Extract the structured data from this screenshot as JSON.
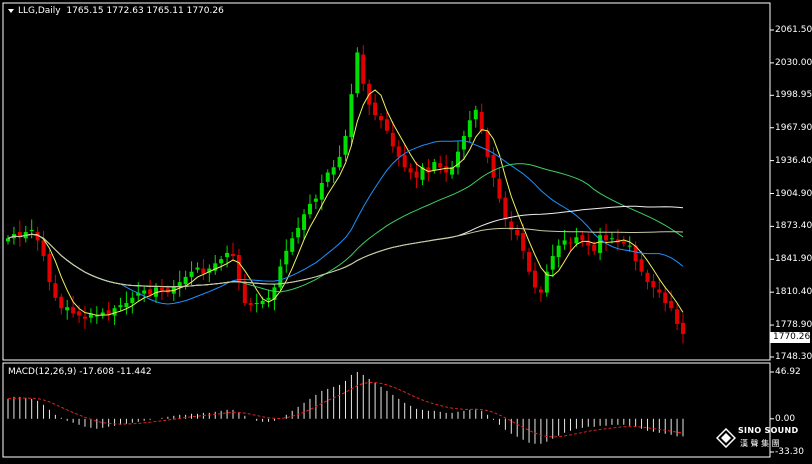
{
  "header": {
    "symbol_timeframe": "LLG,Daily",
    "ohlc": "1765.15 1772.63 1765.11 1770.26"
  },
  "price_axis": {
    "labels": [
      "2061.50",
      "2030.00",
      "1998.95",
      "1967.90",
      "1936.40",
      "1904.90",
      "1873.40",
      "1841.90",
      "1810.40",
      "1778.90",
      "1748.30"
    ],
    "current_price": "1770.26"
  },
  "macd": {
    "label": "MACD(12,26,9) -17.608 -11.442",
    "axis_labels": [
      "46.92",
      "0.00",
      "-33.30"
    ]
  },
  "logo": {
    "line1": "SINO SOUND",
    "line2": "漢 聲 集 團"
  },
  "colors": {
    "background": "#000000",
    "bull": "#00e000",
    "bear": "#e00000",
    "ma_yellow": "#f0f060",
    "ma_blue": "#1e90ff",
    "ma_green": "#3cd060",
    "ma_white": "#f0f0f0",
    "ma_gray": "#c8c8a0",
    "macd_signal": "#e02020",
    "macd_hist": "#e8e8e8"
  },
  "chart_data": {
    "type": "candlestick",
    "title": "LLG,Daily",
    "ylim": [
      1748.3,
      2070
    ],
    "close_series": [
      1862,
      1866,
      1863,
      1868,
      1870,
      1860,
      1845,
      1820,
      1805,
      1795,
      1796,
      1790,
      1788,
      1785,
      1790,
      1788,
      1791,
      1789,
      1795,
      1798,
      1800,
      1805,
      1810,
      1812,
      1808,
      1815,
      1812,
      1810,
      1815,
      1820,
      1825,
      1830,
      1834,
      1828,
      1833,
      1838,
      1842,
      1848,
      1845,
      1820,
      1800,
      1798,
      1800,
      1802,
      1805,
      1815,
      1835,
      1850,
      1862,
      1872,
      1885,
      1895,
      1900,
      1915,
      1925,
      1930,
      1940,
      1960,
      2000,
      2040,
      2010,
      1990,
      1980,
      1975,
      1965,
      1950,
      1940,
      1930,
      1925,
      1920,
      1930,
      1925,
      1935,
      1930,
      1925,
      1930,
      1945,
      1960,
      1975,
      1985,
      1965,
      1940,
      1920,
      1900,
      1880,
      1870,
      1865,
      1850,
      1830,
      1815,
      1810,
      1830,
      1845,
      1855,
      1860,
      1857,
      1863,
      1860,
      1855,
      1850,
      1865,
      1860,
      1862,
      1858,
      1857,
      1855,
      1840,
      1830,
      1820,
      1815,
      1810,
      1800,
      1795,
      1780,
      1770.26
    ],
    "macd_main_approx": [
      20,
      22,
      22,
      21,
      20,
      18,
      14,
      9,
      4,
      1,
      -2,
      -4,
      -6,
      -8,
      -9,
      -10,
      -9,
      -8,
      -7,
      -6,
      -5,
      -4,
      -3,
      -2,
      -1,
      0,
      1,
      2,
      3,
      4,
      4,
      5,
      5,
      6,
      6,
      7,
      8,
      9,
      9,
      6,
      3,
      0,
      -2,
      -3,
      -3,
      -2,
      0,
      4,
      8,
      12,
      16,
      20,
      24,
      28,
      30,
      32,
      34,
      38,
      44,
      47,
      44,
      40,
      36,
      32,
      28,
      24,
      20,
      16,
      13,
      10,
      9,
      8,
      8,
      7,
      6,
      6,
      7,
      8,
      9,
      10,
      8,
      4,
      -1,
      -6,
      -11,
      -15,
      -18,
      -21,
      -24,
      -25,
      -25,
      -23,
      -20,
      -17,
      -14,
      -12,
      -10,
      -9,
      -8,
      -8,
      -7,
      -7,
      -6,
      -6,
      -6,
      -7,
      -8,
      -10,
      -12,
      -13,
      -14,
      -15,
      -16,
      -17.608,
      -17.608
    ],
    "macd_signal_value": -11.442,
    "macd_ylim": [
      -33.3,
      46.92
    ]
  }
}
